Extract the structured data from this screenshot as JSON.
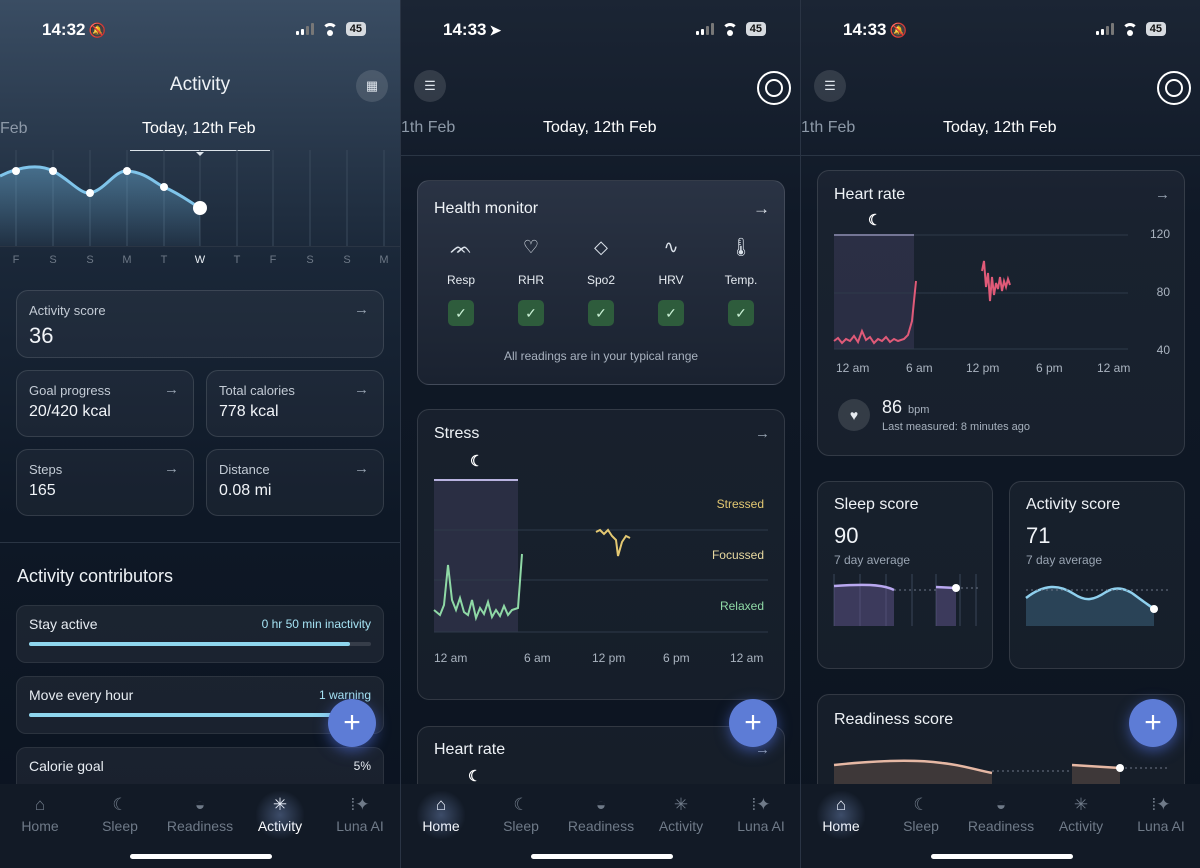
{
  "screens": {
    "activity": {
      "time": "14:32",
      "status_symbol": "🔕",
      "battery": "45",
      "title": "Activity",
      "date_prev": "Feb",
      "date_current": "Today, 12th Feb",
      "week_days": [
        "F",
        "S",
        "S",
        "M",
        "T",
        "W",
        "T",
        "F",
        "S",
        "S",
        "M"
      ],
      "cards": {
        "activity_score": {
          "label": "Activity score",
          "value": "36"
        },
        "goal_progress": {
          "label": "Goal progress",
          "value": "20/420 kcal"
        },
        "total_calories": {
          "label": "Total calories",
          "value": "778 kcal"
        },
        "steps": {
          "label": "Steps",
          "value": "165"
        },
        "distance": {
          "label": "Distance",
          "value": "0.08 mi"
        }
      },
      "arrow": "→",
      "contributors_title": "Activity contributors",
      "contributors": [
        {
          "name": "Stay active",
          "info": "0 hr 50 min inactivity",
          "progress": 0.94
        },
        {
          "name": "Move every hour",
          "info": "1 warning",
          "progress": 0.97
        },
        {
          "name": "Calorie goal",
          "info": "5%",
          "progress": 0.05
        }
      ]
    },
    "home_health": {
      "time": "14:33",
      "status_symbol": "➤",
      "battery": "45",
      "date_prev": "1th Feb",
      "date_current": "Today, 12th Feb",
      "health_monitor": {
        "title": "Health monitor",
        "items": [
          {
            "label": "Resp",
            "icon": "lungs-icon"
          },
          {
            "label": "RHR",
            "icon": "heart-down-icon"
          },
          {
            "label": "Spo2",
            "icon": "drop-o2-icon"
          },
          {
            "label": "HRV",
            "icon": "pulse-icon"
          },
          {
            "label": "Temp.",
            "icon": "thermometer-icon"
          }
        ],
        "note": "All readings are in your typical range"
      },
      "stress": {
        "title": "Stress",
        "levels": [
          "Stressed",
          "Focussed",
          "Relaxed"
        ],
        "x_labels": [
          "12 am",
          "6 am",
          "12 pm",
          "6 pm",
          "12 am"
        ]
      },
      "heart_rate_title": "Heart rate"
    },
    "home_scores": {
      "time": "14:33",
      "status_symbol": "🔕",
      "battery": "45",
      "date_prev": "1th Feb",
      "date_current": "Today, 12th Feb",
      "heart_rate": {
        "title": "Heart rate",
        "y_labels": [
          "120",
          "80",
          "40"
        ],
        "x_labels": [
          "12 am",
          "6 am",
          "12 pm",
          "6 pm",
          "12 am"
        ],
        "value": "86",
        "unit": "bpm",
        "last_measured": "Last measured: 8 minutes ago"
      },
      "sleep_score": {
        "title": "Sleep score",
        "value": "90",
        "sub": "7 day average"
      },
      "activity_score": {
        "title": "Activity score",
        "value": "71",
        "sub": "7 day average"
      },
      "readiness_title": "Readiness score"
    }
  },
  "nav": {
    "items": [
      {
        "label": "Home",
        "icon": "home-icon"
      },
      {
        "label": "Sleep",
        "icon": "moon-icon"
      },
      {
        "label": "Readiness",
        "icon": "sunrise-icon"
      },
      {
        "label": "Activity",
        "icon": "sparkle-icon"
      },
      {
        "label": "Luna AI",
        "icon": "ai-icon"
      }
    ]
  },
  "colors": {
    "accent_blue": "#5d7cd6",
    "progress": "#8fd6ee",
    "heart": "#e05a78",
    "stress_yellow": "#e3c872",
    "relaxed_green": "#8fd9a6"
  }
}
